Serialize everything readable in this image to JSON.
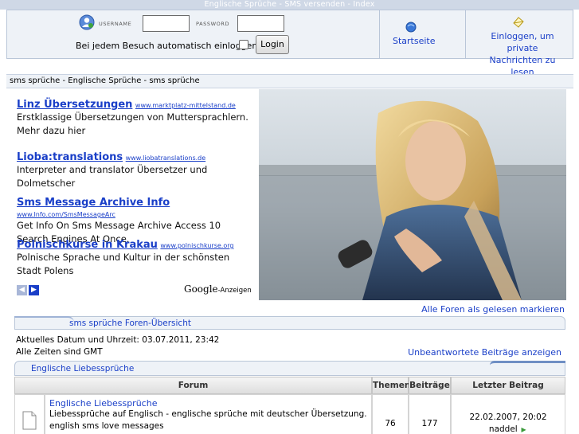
{
  "window": {
    "title": "Englische Sprüche - SMS versenden - Index"
  },
  "login": {
    "username_label": "USERNAME",
    "password_label": "PASSWORD",
    "autologin_label": "Bei jedem Besuch automatisch einloggen",
    "login_button": "Login",
    "username_value": "",
    "password_value": ""
  },
  "nav": {
    "home_label": "Startseite",
    "messages_line1": "Einloggen, um private",
    "messages_line2": "Nachrichten zu lesen"
  },
  "breadcrumb": "sms sprüche - Englische Sprüche - sms sprüche",
  "ads": [
    {
      "title": "Linz Übersetzungen",
      "url": "www.marktplatz-mittelstand.de",
      "line1": "Erstklassige Übersetzungen von Muttersprachlern.",
      "line2": "Mehr dazu hier"
    },
    {
      "title": "Lioba:translations",
      "url": "www.liobatranslations.de",
      "line1": "Interpreter and translator Übersetzer und",
      "line2": "Dolmetscher"
    },
    {
      "title": "Sms Message Archive Info",
      "url": "www.Info.com/SmsMessageArc",
      "line1": "Get Info On Sms Message Archive Access 10",
      "line2": "Search Engines At Once."
    },
    {
      "title": "Polnischkurse in Krakau",
      "url": "www.polnischkurse.org",
      "line1": "Polnische Sprache und Kultur in der schönsten",
      "line2": "Stadt Polens"
    }
  ],
  "google": {
    "brand": "Google",
    "suffix": "-Anzeigen"
  },
  "links": {
    "mark_read": "Alle Foren als gelesen markieren",
    "unanswered": "Unbeantwortete Beiträge anzeigen"
  },
  "overview": "sms sprüche Foren-Übersicht",
  "info": {
    "date_line": "Aktuelles Datum und Uhrzeit: 03.07.2011, 23:42",
    "tz_line": "Alle Zeiten sind GMT"
  },
  "category": "Englische Liebessprüche",
  "table": {
    "headers": {
      "forum": "Forum",
      "topics": "Themen",
      "posts": "Beiträge",
      "last": "Letzter Beitrag"
    },
    "rows": [
      {
        "name": "Englische Liebessprüche",
        "desc1": "Liebessprüche auf Englisch - englische sprüche mit deutscher Übersetzung.",
        "desc2": "english sms love messages",
        "topics": "76",
        "posts": "177",
        "last_date": "22.02.2007, 20:02",
        "last_user": "naddel"
      }
    ]
  },
  "colors": {
    "link": "#1a3fc8",
    "panel": "#eef2f7",
    "border": "#b9c6d8"
  }
}
